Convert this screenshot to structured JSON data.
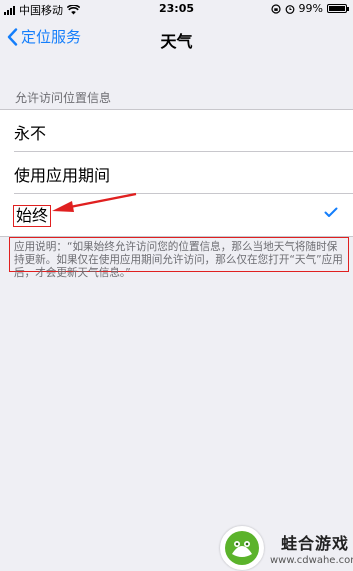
{
  "status_bar": {
    "carrier": "中国移动",
    "time": "23:05",
    "battery_percent": "99%",
    "battery_level": 0.99
  },
  "nav": {
    "back_label": "定位服务",
    "title": "天气"
  },
  "section_header": "允许访问位置信息",
  "options": [
    {
      "label": "永不",
      "selected": false
    },
    {
      "label": "使用应用期间",
      "selected": false
    },
    {
      "label": "始终",
      "selected": true
    }
  ],
  "footer_text": "应用说明：“如果始终允许访问您的位置信息，那么当地天气将随时保持更新。如果仅在使用应用期间允许访问，那么仅在您打开“天气”应用后，才会更新天气信息。”",
  "watermark": {
    "name": "蛙合游戏",
    "url": "www.cdwahe.com"
  },
  "colors": {
    "accent": "#147efb",
    "annotation": "#e02020",
    "background": "#efeff4",
    "watermark_green": "#5bb32b"
  },
  "icons": [
    "signal-icon",
    "wifi-icon",
    "lock-rotation-icon",
    "alarm-icon",
    "battery-icon",
    "chevron-left-icon",
    "checkmark-icon",
    "red-arrow-annotation",
    "frog-logo"
  ]
}
